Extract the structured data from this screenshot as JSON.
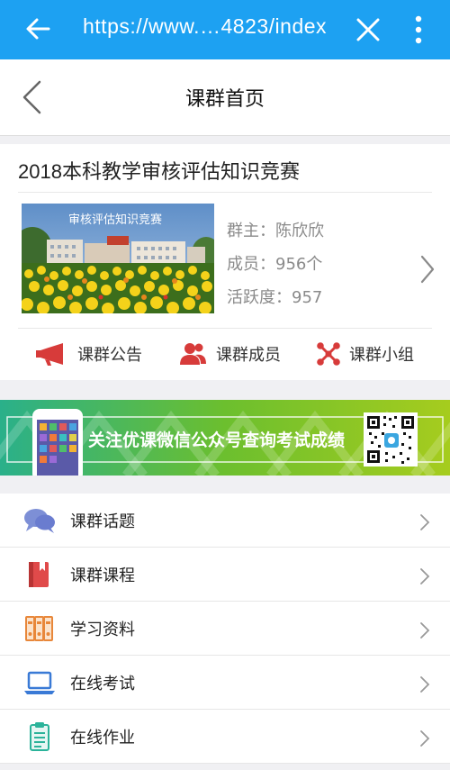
{
  "browser": {
    "url": "https://www.…4823/index",
    "back_icon": "arrow-left-icon",
    "close_icon": "close-icon",
    "more_icon": "more-vertical-icon",
    "bar_color": "#1da1f2"
  },
  "header": {
    "title": "课群首页",
    "back_icon": "chevron-left-icon"
  },
  "course": {
    "title": "2018本科教学审核评估知识竞赛",
    "cover_caption": "审核评估知识竞赛",
    "owner": "群主：陈欣欣",
    "members": "成员：956个",
    "activity": "活跃度：957"
  },
  "actions": [
    {
      "label": "课群公告",
      "icon": "megaphone-icon"
    },
    {
      "label": "课群成员",
      "icon": "members-icon"
    },
    {
      "label": "课群小组",
      "icon": "group-icon"
    }
  ],
  "banner": {
    "text": "关注优课微信公众号查询考试成绩",
    "qr_icon": "qr-code-icon",
    "phone_icon": "phone-icon"
  },
  "menu": [
    {
      "label": "课群话题",
      "icon": "chat-bubbles-icon"
    },
    {
      "label": "课群课程",
      "icon": "book-icon"
    },
    {
      "label": "学习资料",
      "icon": "binders-icon"
    },
    {
      "label": "在线考试",
      "icon": "laptop-icon"
    },
    {
      "label": "在线作业",
      "icon": "clipboard-icon"
    }
  ]
}
